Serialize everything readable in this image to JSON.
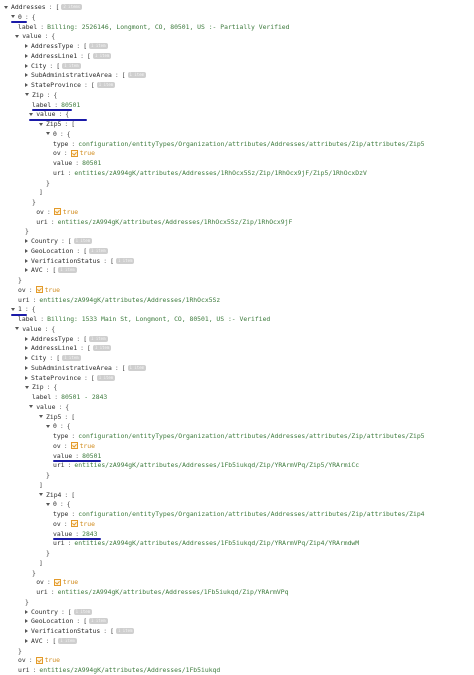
{
  "addresses_key": "Addresses",
  "addresses_badge": "2 items",
  "items": [
    {
      "index": "0",
      "label": "Billing: 2526146, Longmont, CO, 80501, US :- Partially Verified",
      "collapsed_attrs": [
        {
          "name": "AddressType",
          "badge": "1 item"
        },
        {
          "name": "AddressLine1",
          "badge": "1 item"
        },
        {
          "name": "City",
          "badge": "1 item"
        },
        {
          "name": "SubAdministrativeArea",
          "badge": "1 item"
        },
        {
          "name": "StateProvince",
          "badge": "1 item"
        }
      ],
      "zip": {
        "label": "80501",
        "subs": [
          {
            "name": "Zip5",
            "index": "0",
            "type": "configuration/entityTypes/Organization/attributes/Addresses/attributes/Zip/attributes/Zip5",
            "ov": "true",
            "value": "80501",
            "uri": "entities/zA994gK/attributes/Addresses/1RhOcx5Sz/Zip/1RhOcx9jF/Zip5/1RhOcxDzV"
          }
        ],
        "ov": "true",
        "uri": "entities/zA994gK/attributes/Addresses/1RhOcx5Sz/Zip/1RhOcx9jF"
      },
      "after_attrs": [
        {
          "name": "Country",
          "badge": "1 item"
        },
        {
          "name": "GeoLocation",
          "badge": "1 item"
        },
        {
          "name": "VerificationStatus",
          "badge": "1 item"
        },
        {
          "name": "AVC",
          "badge": "1 item"
        }
      ],
      "ov": "true",
      "uri": "entities/zA994gK/attributes/Addresses/1RhOcx5Sz"
    },
    {
      "index": "1",
      "label": "Billing: 1533 Main St, Longmont, CO, 80501, US :- Verified",
      "collapsed_attrs": [
        {
          "name": "AddressType",
          "badge": "1 item"
        },
        {
          "name": "AddressLine1",
          "badge": "1 item"
        },
        {
          "name": "City",
          "badge": "1 item"
        },
        {
          "name": "SubAdministrativeArea",
          "badge": "1 item"
        },
        {
          "name": "StateProvince",
          "badge": "1 item"
        }
      ],
      "zip": {
        "label": "80501 - 2843",
        "subs": [
          {
            "name": "Zip5",
            "index": "0",
            "type": "configuration/entityTypes/Organization/attributes/Addresses/attributes/Zip/attributes/Zip5",
            "ov": "true",
            "value": "80501",
            "uri": "entities/zA994gK/attributes/Addresses/1Fb5iukqd/Zip/YRArmVPq/Zip5/YRArmiCc"
          },
          {
            "name": "Zip4",
            "index": "0",
            "type": "configuration/entityTypes/Organization/attributes/Addresses/attributes/Zip/attributes/Zip4",
            "ov": "true",
            "value": "2843",
            "uri": "entities/zA994gK/attributes/Addresses/1Fb5iukqd/Zip/YRArmVPq/Zip4/YRArmdwM"
          }
        ],
        "ov": "true",
        "uri": "entities/zA994gK/attributes/Addresses/1Fb5iukqd/Zip/YRArmVPq"
      },
      "after_attrs": [
        {
          "name": "Country",
          "badge": "1 item"
        },
        {
          "name": "GeoLocation",
          "badge": "1 item"
        },
        {
          "name": "VerificationStatus",
          "badge": "1 item"
        },
        {
          "name": "AVC",
          "badge": "1 item"
        }
      ],
      "ov": "true",
      "uri": "entities/zA994gK/attributes/Addresses/1Fb5iukqd"
    }
  ],
  "keys": {
    "label": "label",
    "value": "value",
    "zip": "Zip",
    "type": "type",
    "ov": "ov",
    "uri": "uri"
  },
  "colors": {
    "string": "#3c7a3c",
    "bool": "#d08a1a",
    "annotation": "#1a1aa8"
  }
}
